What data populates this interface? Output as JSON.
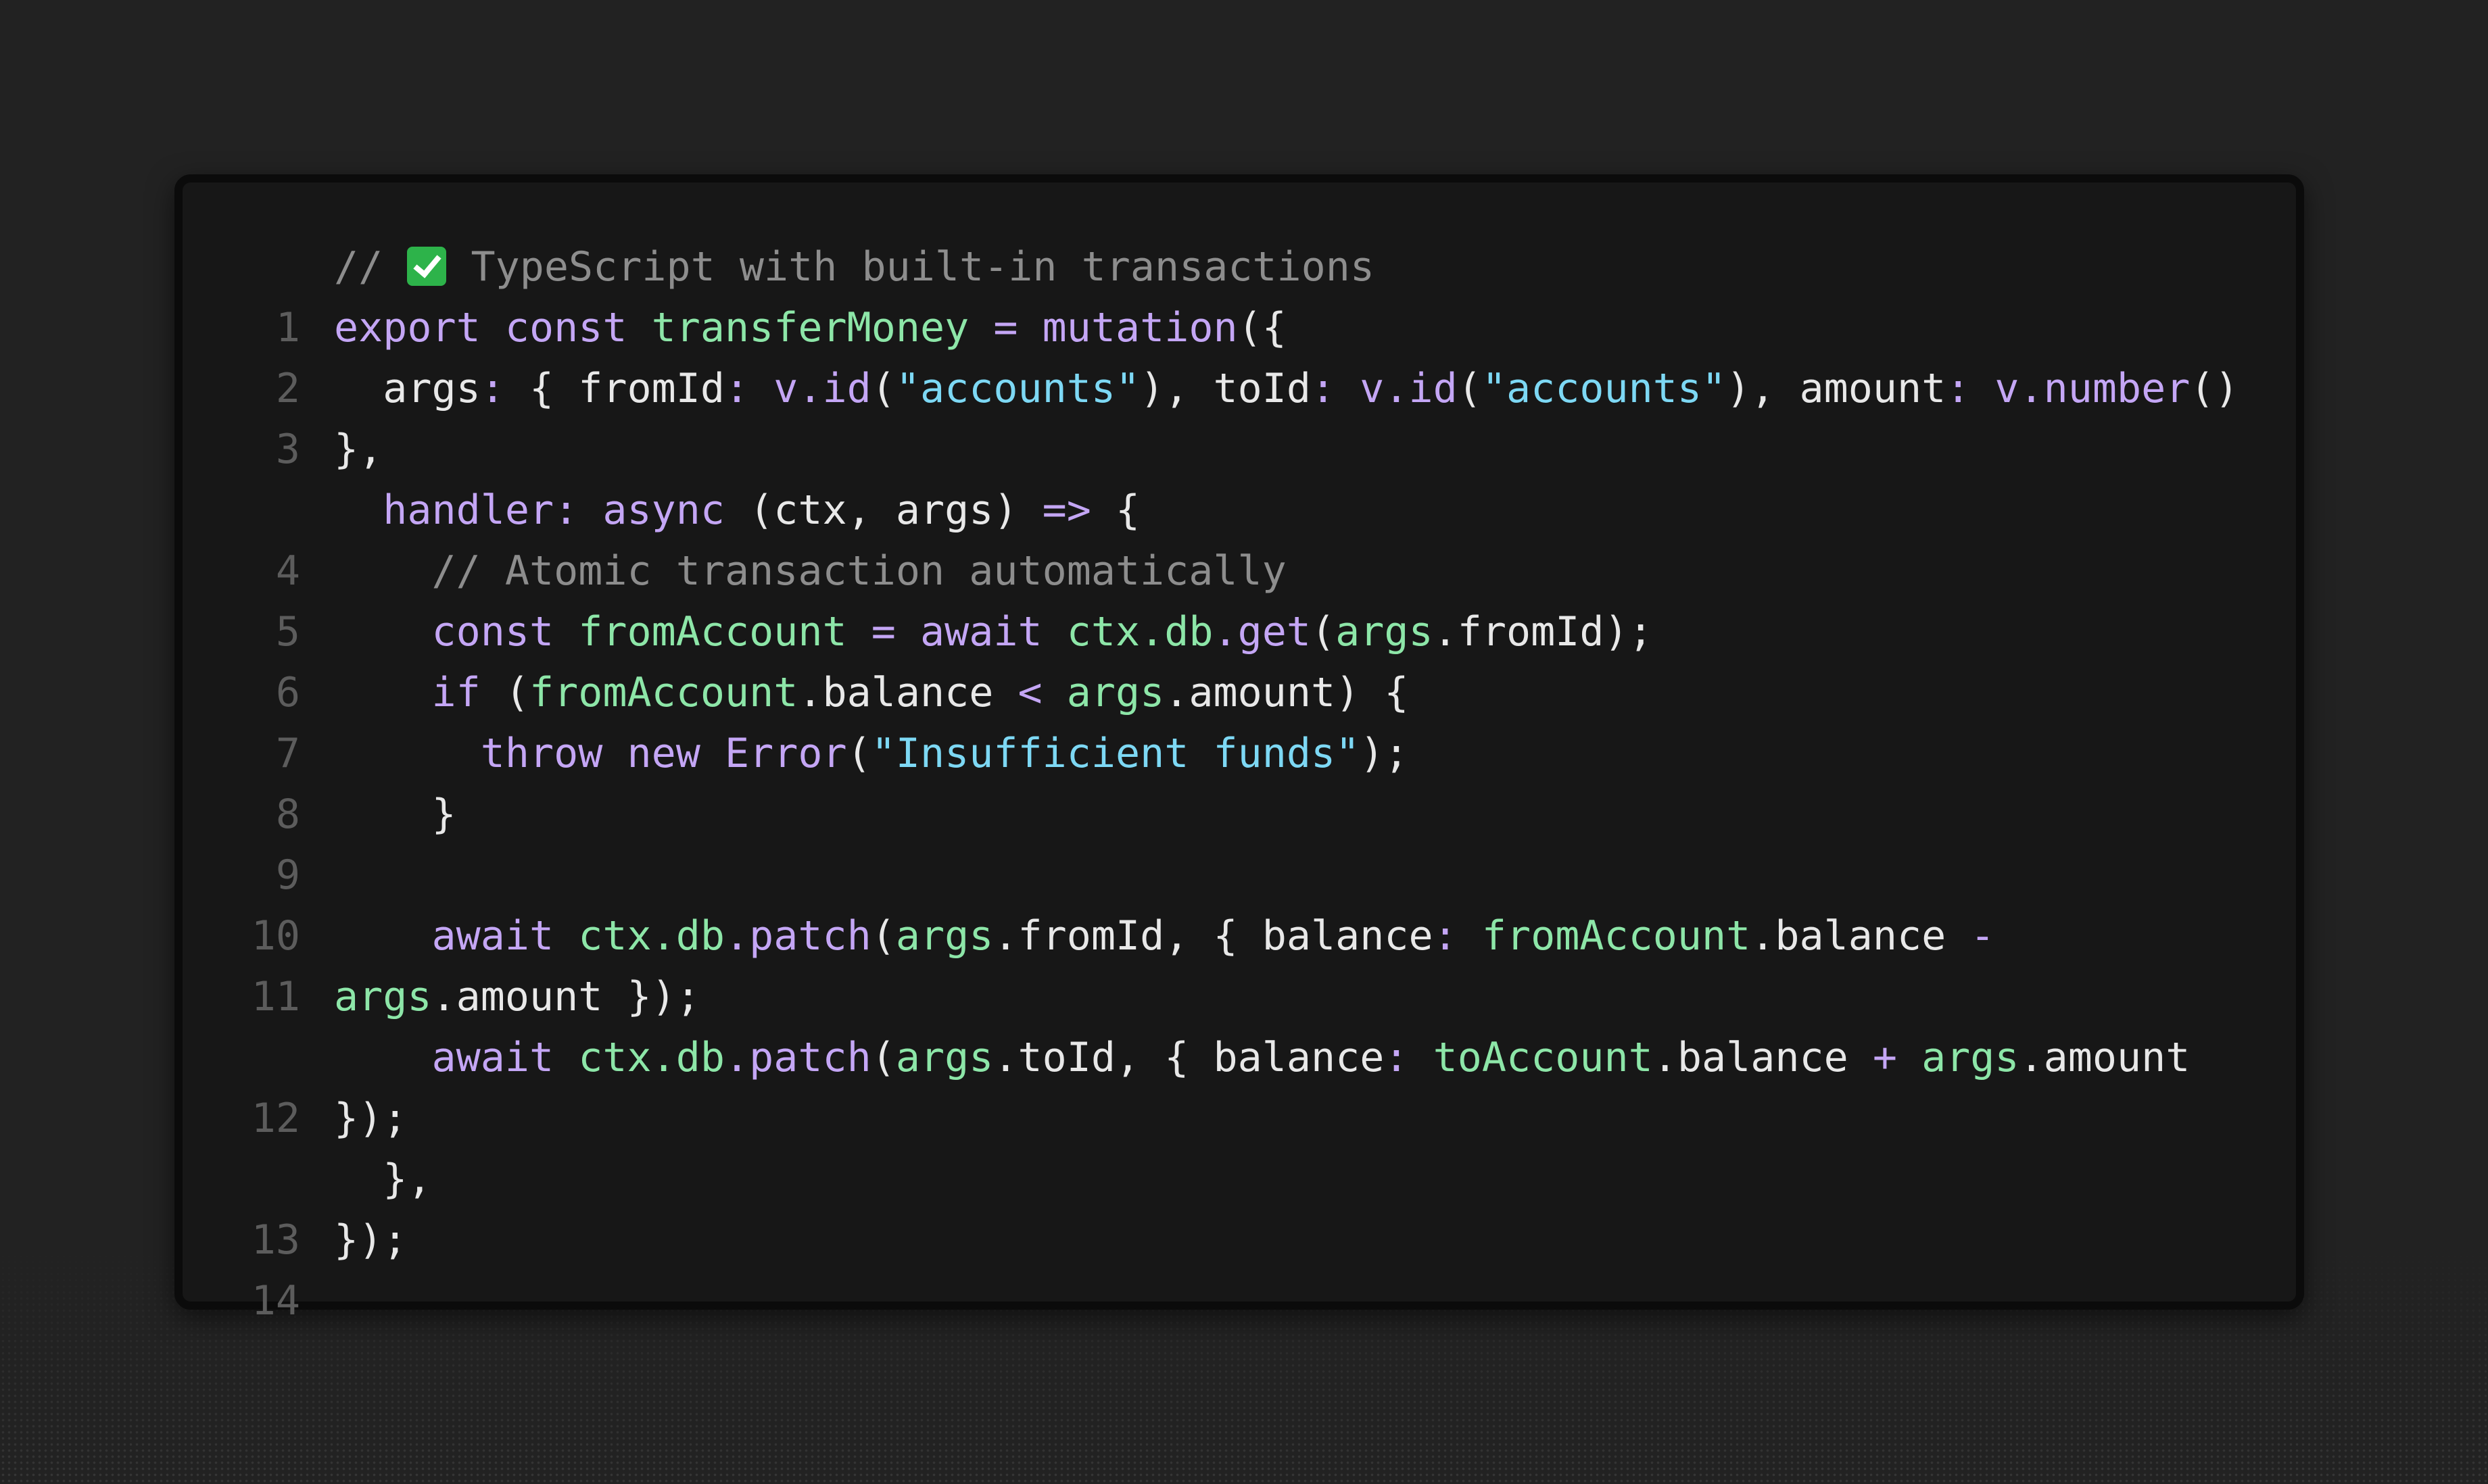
{
  "editor": {
    "lines": [
      {
        "num": "1",
        "text": "// ✅ TypeScript with built-in transactions"
      },
      {
        "num": "2",
        "text": "export const transferMoney = mutation({"
      },
      {
        "num": "3",
        "text": "  args: { fromId: v.id(\"accounts\"), toId: v.id(\"accounts\"), amount: v.number() },"
      },
      {
        "num": "4",
        "text": "  handler: async (ctx, args) => {"
      },
      {
        "num": "5",
        "text": "    // Atomic transaction automatically"
      },
      {
        "num": "6",
        "text": "    const fromAccount = await ctx.db.get(args.fromId);"
      },
      {
        "num": "7",
        "text": "    if (fromAccount.balance < args.amount) {"
      },
      {
        "num": "8",
        "text": "      throw new Error(\"Insufficient funds\");"
      },
      {
        "num": "9",
        "text": "    }"
      },
      {
        "num": "10",
        "text": ""
      },
      {
        "num": "11",
        "text": "    await ctx.db.patch(args.fromId, { balance: fromAccount.balance - args.amount });"
      },
      {
        "num": "12",
        "text": "    await ctx.db.patch(args.toId, { balance: toAccount.balance + args.amount });"
      },
      {
        "num": "13",
        "text": "  },"
      },
      {
        "num": "14",
        "text": "});"
      }
    ]
  },
  "colors": {
    "background": "#222222",
    "panel": "#171717",
    "comment": "#8d8d8d",
    "keyword": "#c4a6f5",
    "function": "#8de6a8",
    "string": "#7dd8f4",
    "plain": "#e8e8e8",
    "line_number": "#5c5c5c"
  },
  "icons": [
    "check-mark-icon"
  ]
}
